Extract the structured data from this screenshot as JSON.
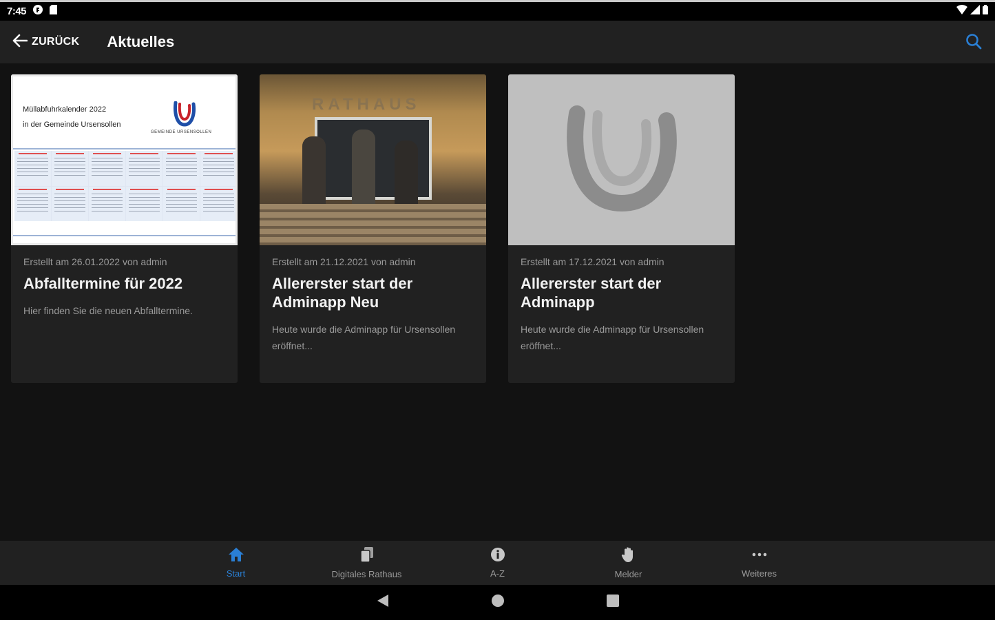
{
  "status_bar": {
    "time": "7:45",
    "icons": [
      "app-notification-icon",
      "sd-card-icon",
      "wifi-icon",
      "signal-icon",
      "battery-icon"
    ]
  },
  "app_bar": {
    "back_label": "ZURÜCK",
    "title": "Aktuelles",
    "search_icon": "search-icon",
    "accent_color": "#2a7fd4"
  },
  "cards": [
    {
      "meta": "Erstellt am 26.01.2022 von admin",
      "title": "Abfalltermine für 2022",
      "text": "Hier finden Sie die neuen Abfalltermine.",
      "image": {
        "line1": "Müllabfuhrkalender 2022",
        "line2": "in der Gemeinde Ursensollen",
        "logo_caption": "GEMEINDE URSENSOLLEN"
      }
    },
    {
      "meta": "Erstellt am 21.12.2021 von admin",
      "title": "Allererster start der Adminapp Neu",
      "text": "Heute wurde die Adminapp für Ursensollen eröffnet...",
      "image": {
        "sign": "RATHAUS"
      }
    },
    {
      "meta": "Erstellt am 17.12.2021 von admin",
      "title": "Allererster start der Adminapp",
      "text": "Heute wurde die Adminapp für Ursensollen eröffnet..."
    }
  ],
  "bottom_nav": {
    "items": [
      {
        "label": "Start",
        "icon": "home-icon",
        "active": true
      },
      {
        "label": "Digitales Rathaus",
        "icon": "documents-icon",
        "active": false
      },
      {
        "label": "A-Z",
        "icon": "info-icon",
        "active": false
      },
      {
        "label": "Melder",
        "icon": "hand-icon",
        "active": false
      },
      {
        "label": "Weiteres",
        "icon": "more-icon",
        "active": false
      }
    ]
  },
  "system_nav": {
    "icons": [
      "back-triangle-icon",
      "home-circle-icon",
      "recents-square-icon"
    ]
  }
}
